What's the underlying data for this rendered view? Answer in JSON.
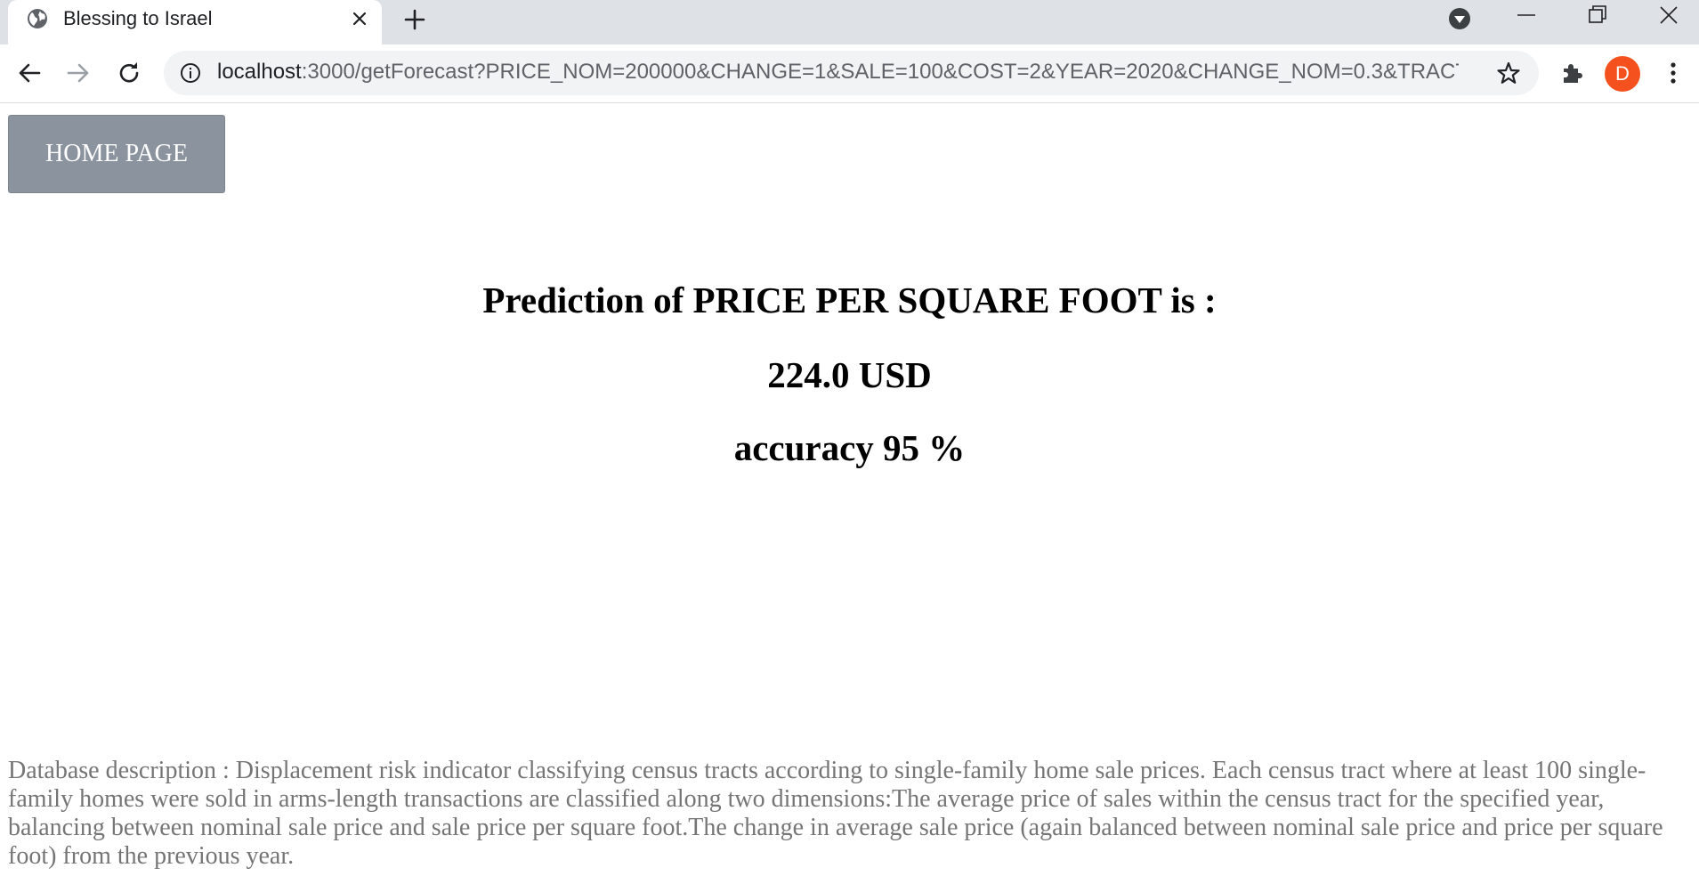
{
  "browser": {
    "tab_title": "Blessing to Israel",
    "url_host": "localhost",
    "url_rest": ":3000/getForecast?PRICE_NOM=200000&CHANGE=1&SALE=100&COST=2&YEAR=2020&CHANGE_NOM=0.3&TRACT...",
    "profile_initial": "D",
    "icons": [
      "globe-icon",
      "close-icon",
      "plus-icon",
      "tab-search-icon",
      "minimize-icon",
      "restore-icon",
      "window-close-icon",
      "back-arrow-icon",
      "forward-arrow-icon",
      "reload-icon",
      "info-icon",
      "star-icon",
      "puzzle-icon",
      "kebab-menu-icon"
    ],
    "colors": {
      "tabstrip": "#dee1e6",
      "omnibox": "#f1f3f4",
      "avatar": "#f4511e"
    }
  },
  "page": {
    "home_button_label": "HOME PAGE",
    "prediction_heading": "Prediction of PRICE PER SQUARE FOOT is :",
    "prediction_value": "224.0 USD",
    "accuracy_text": "accuracy 95 %",
    "description": "Database description : Displacement risk indicator classifying census tracts according to single-family home sale prices. Each census tract where at least 100 single-family homes were sold in arms-length transactions are classified along two dimensions:The average price of sales within the census tract for the specified year, balancing between nominal sale price and sale price per square foot.The change in average sale price (again balanced between nominal sale price and price per square foot) from the previous year.",
    "colors": {
      "home_button_bg": "#8b949e",
      "description_text": "#757575"
    }
  }
}
